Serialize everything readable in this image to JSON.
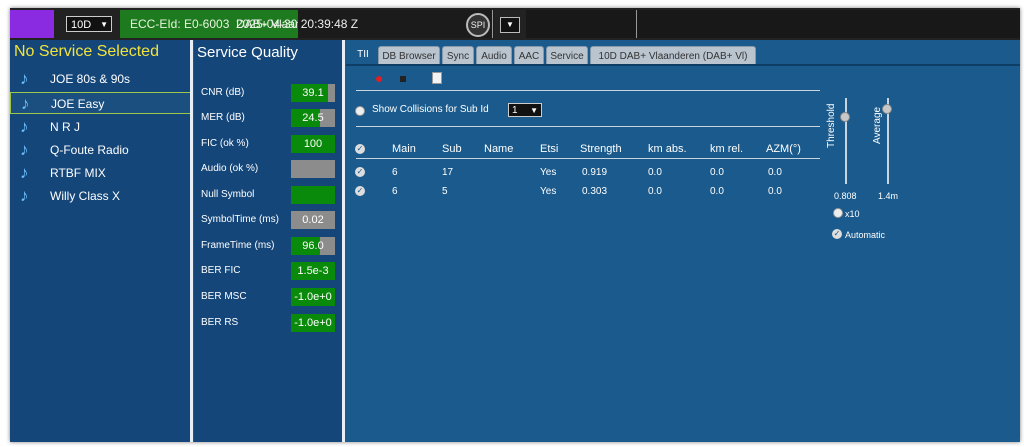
{
  "topbar": {
    "channel": "10D",
    "ecc_eid": "ECC-EId: E0-6003",
    "ensemble": "DAB+ Vlaanderen",
    "datetime": "2025-04-30  20:39:48 Z",
    "spi_label": "SPI"
  },
  "services": {
    "title": "No Service Selected",
    "items": [
      {
        "label": "JOE 80s & 90s"
      },
      {
        "label": "JOE Easy"
      },
      {
        "label": "N R J"
      },
      {
        "label": "Q-Foute Radio"
      },
      {
        "label": "RTBF MIX"
      },
      {
        "label": "Willy Class X"
      }
    ]
  },
  "quality": {
    "title": "Service Quality",
    "rows": [
      {
        "label": "CNR (dB)",
        "value": "39.1",
        "level": 0.85
      },
      {
        "label": "MER (dB)",
        "value": "24.5",
        "level": 0.65
      },
      {
        "label": "FIC (ok %)",
        "value": "100",
        "level": 1.0
      },
      {
        "label": "Audio (ok %)",
        "value": "",
        "level": 0.0
      },
      {
        "label": "Null Symbol",
        "value": "",
        "level": 1.0
      },
      {
        "label": "SymbolTime (ms)",
        "value": "0.02",
        "level": 0.0
      },
      {
        "label": "FrameTime (ms)",
        "value": "96.0",
        "level": 0.65
      },
      {
        "label": "BER FIC",
        "value": "1.5e-3",
        "level": 1.0
      },
      {
        "label": "BER MSC",
        "value": "-1.0e+0",
        "level": 1.0
      },
      {
        "label": "BER RS",
        "value": "-1.0e+0",
        "level": 1.0
      }
    ]
  },
  "tabs": [
    {
      "label": "TII"
    },
    {
      "label": "DB Browser"
    },
    {
      "label": "Sync"
    },
    {
      "label": "Audio"
    },
    {
      "label": "AAC"
    },
    {
      "label": "Service"
    },
    {
      "label": "10D DAB+ Vlaanderen (DAB+ Vl)"
    }
  ],
  "tii": {
    "collisions_label": "Show Collisions for Sub Id",
    "sub_id": "1",
    "columns": [
      "Main",
      "Sub",
      "Name",
      "Etsi",
      "Strength",
      "km abs.",
      "km rel.",
      "AZM(°)"
    ],
    "rows": [
      [
        "6",
        "17",
        "",
        "Yes",
        "0.919",
        "0.0",
        "0.0",
        "0.0"
      ],
      [
        "6",
        "5",
        "",
        "Yes",
        "0.303",
        "0.0",
        "0.0",
        "0.0"
      ]
    ],
    "threshold_label": "Threshold",
    "threshold_value": "0.808",
    "average_label": "Average",
    "average_value": "1.4m",
    "x10_label": "x10",
    "automatic_label": "Automatic"
  },
  "colors": {
    "accent_green": "#0a8a0a",
    "title_yellow": "#f2e33a",
    "background_blue": "#1a5a8c"
  }
}
